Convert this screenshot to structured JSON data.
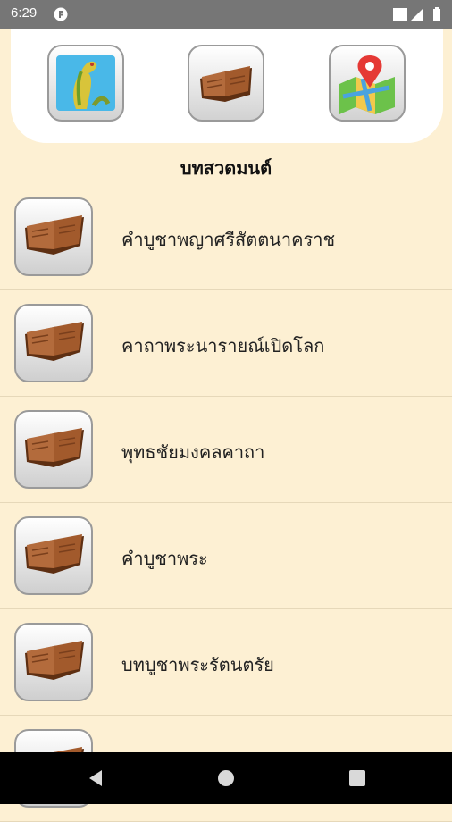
{
  "status_bar": {
    "time": "6:29",
    "icons": [
      "notification-app-icon",
      "wifi-icon",
      "signal-icon",
      "battery-icon"
    ]
  },
  "header": {
    "buttons": [
      {
        "icon": "naga-image-icon"
      },
      {
        "icon": "book-icon"
      },
      {
        "icon": "map-location-icon"
      }
    ]
  },
  "section_title": "บทสวดมนต์",
  "items": [
    {
      "label": "คำบูชาพญาศรีสัตตนาคราช",
      "icon": "book-icon"
    },
    {
      "label": "คาถาพระนารายณ์เปิดโลก",
      "icon": "book-icon"
    },
    {
      "label": "พุทธชัยมงคลคาถา",
      "icon": "book-icon"
    },
    {
      "label": "คำบูชาพระ",
      "icon": "book-icon"
    },
    {
      "label": "บทบูชาพระรัตนตรัย",
      "icon": "book-icon"
    },
    {
      "label": "",
      "icon": "book-icon"
    }
  ],
  "nav": [
    "back-icon",
    "home-icon",
    "recents-icon"
  ],
  "colors": {
    "background": "#fdf0d3",
    "status_bar": "#767676",
    "nav_bar": "#000000",
    "book": "#8b4a22"
  }
}
